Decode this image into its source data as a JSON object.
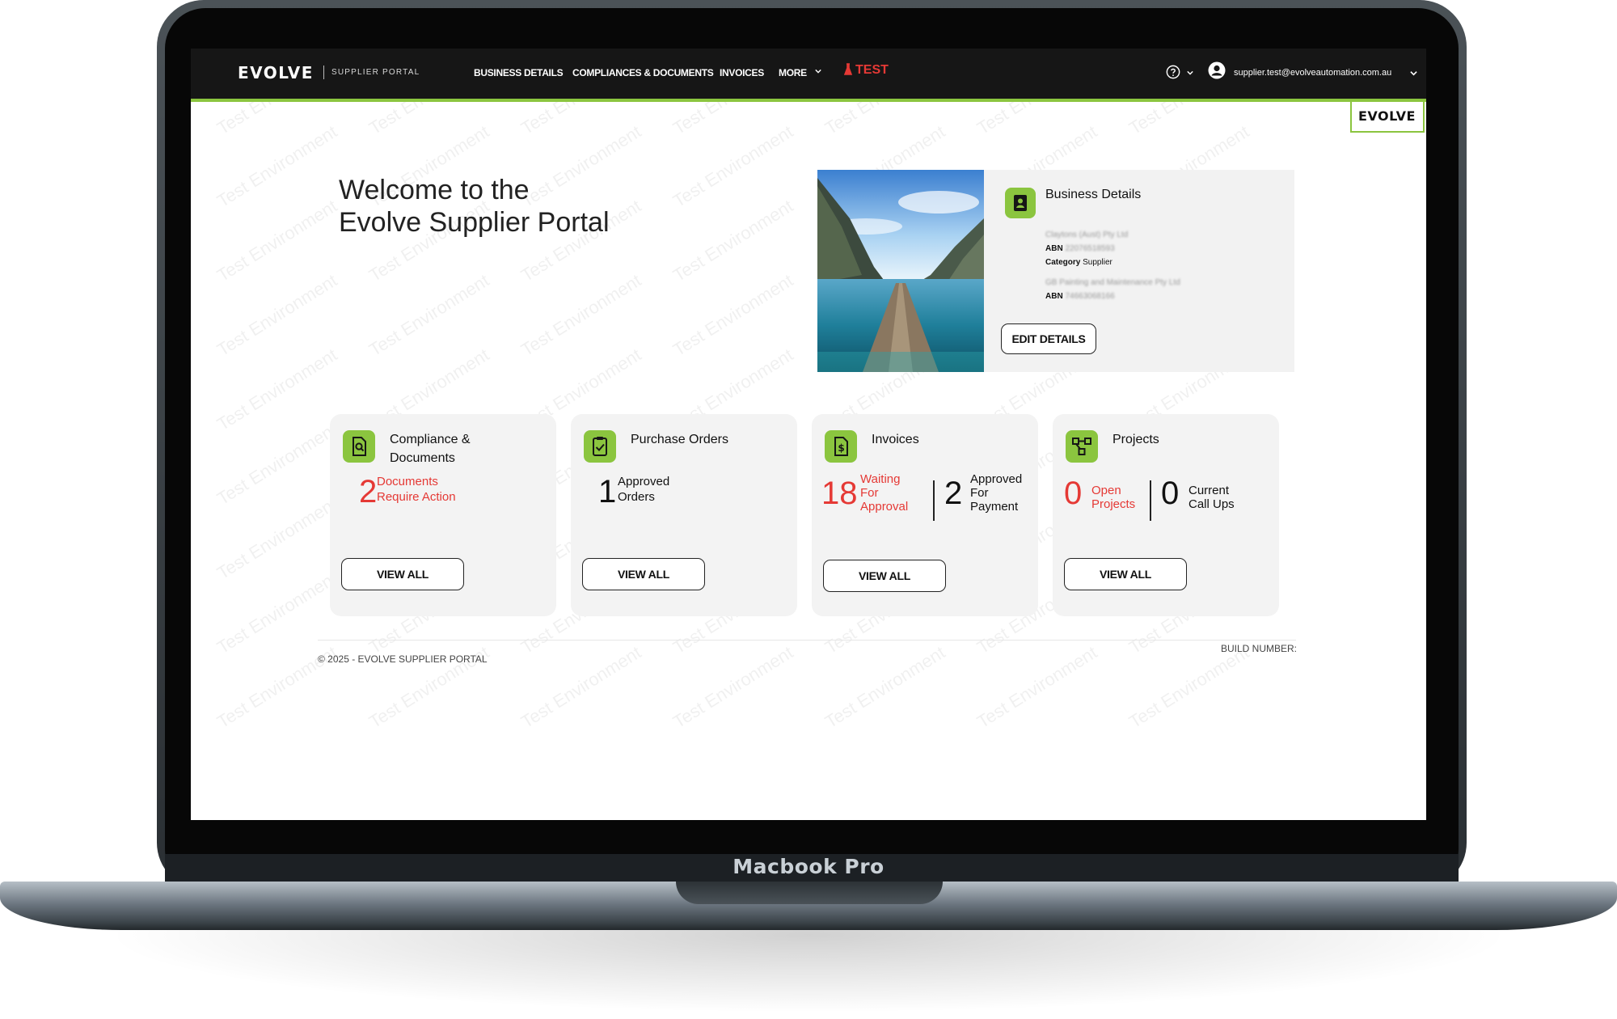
{
  "device": {
    "model_label": "Macbook Pro"
  },
  "header": {
    "brand": "EVOLVE",
    "brand_sub": "SUPPLIER PORTAL",
    "nav": [
      {
        "label": "BUSINESS DETAILS"
      },
      {
        "label": "COMPLIANCES & DOCUMENTS"
      },
      {
        "label": "INVOICES"
      },
      {
        "label": "MORE"
      }
    ],
    "env_badge": "TEST",
    "user_email": "supplier.test@evolveautomation.com.au",
    "corner_logo": "EVOLVE"
  },
  "watermark": "Test Environment",
  "welcome": {
    "line1": "Welcome to the",
    "line2": "Evolve Supplier Portal"
  },
  "business": {
    "title": "Business Details",
    "company1": "Claytons (Aust) Pty Ltd",
    "abn_label": "ABN",
    "abn1": "22076518593",
    "category_label": "Category",
    "category_value": "Supplier",
    "company2": "GB Painting and Maintenance Pty Ltd",
    "abn2": "74663068166",
    "edit_button": "EDIT DETAILS"
  },
  "cards": [
    {
      "title_line1": "Compliance &",
      "title_line2": "Documents",
      "value": "2",
      "label_line1": "Documents",
      "label_line2": "Require Action",
      "button": "VIEW ALL",
      "icon": "document-search-icon"
    },
    {
      "title_line1": "Purchase Orders",
      "value": "1",
      "label_line1": "Approved",
      "label_line2": "Orders",
      "button": "VIEW ALL",
      "icon": "clipboard-check-icon"
    },
    {
      "title_line1": "Invoices",
      "value": "18",
      "label_line1": "Waiting",
      "label_line2": "For",
      "label_line3": "Approval",
      "value2": "2",
      "label2_line1": "Approved",
      "label2_line2": "For",
      "label2_line3": "Payment",
      "button": "VIEW ALL",
      "icon": "invoice-dollar-icon"
    },
    {
      "title_line1": "Projects",
      "value": "0",
      "label_line1": "Open",
      "label_line2": "Projects",
      "value2": "0",
      "label2_line1": "Current",
      "label2_line2": "Call Ups",
      "button": "VIEW ALL",
      "icon": "project-flow-icon"
    }
  ],
  "footer": {
    "copyright": "© 2025 - EVOLVE SUPPLIER PORTAL",
    "build": "BUILD NUMBER:"
  },
  "colors": {
    "accent": "#8bc53f",
    "alert": "#e53935",
    "topbar": "#161616",
    "card": "#f3f3f3"
  }
}
